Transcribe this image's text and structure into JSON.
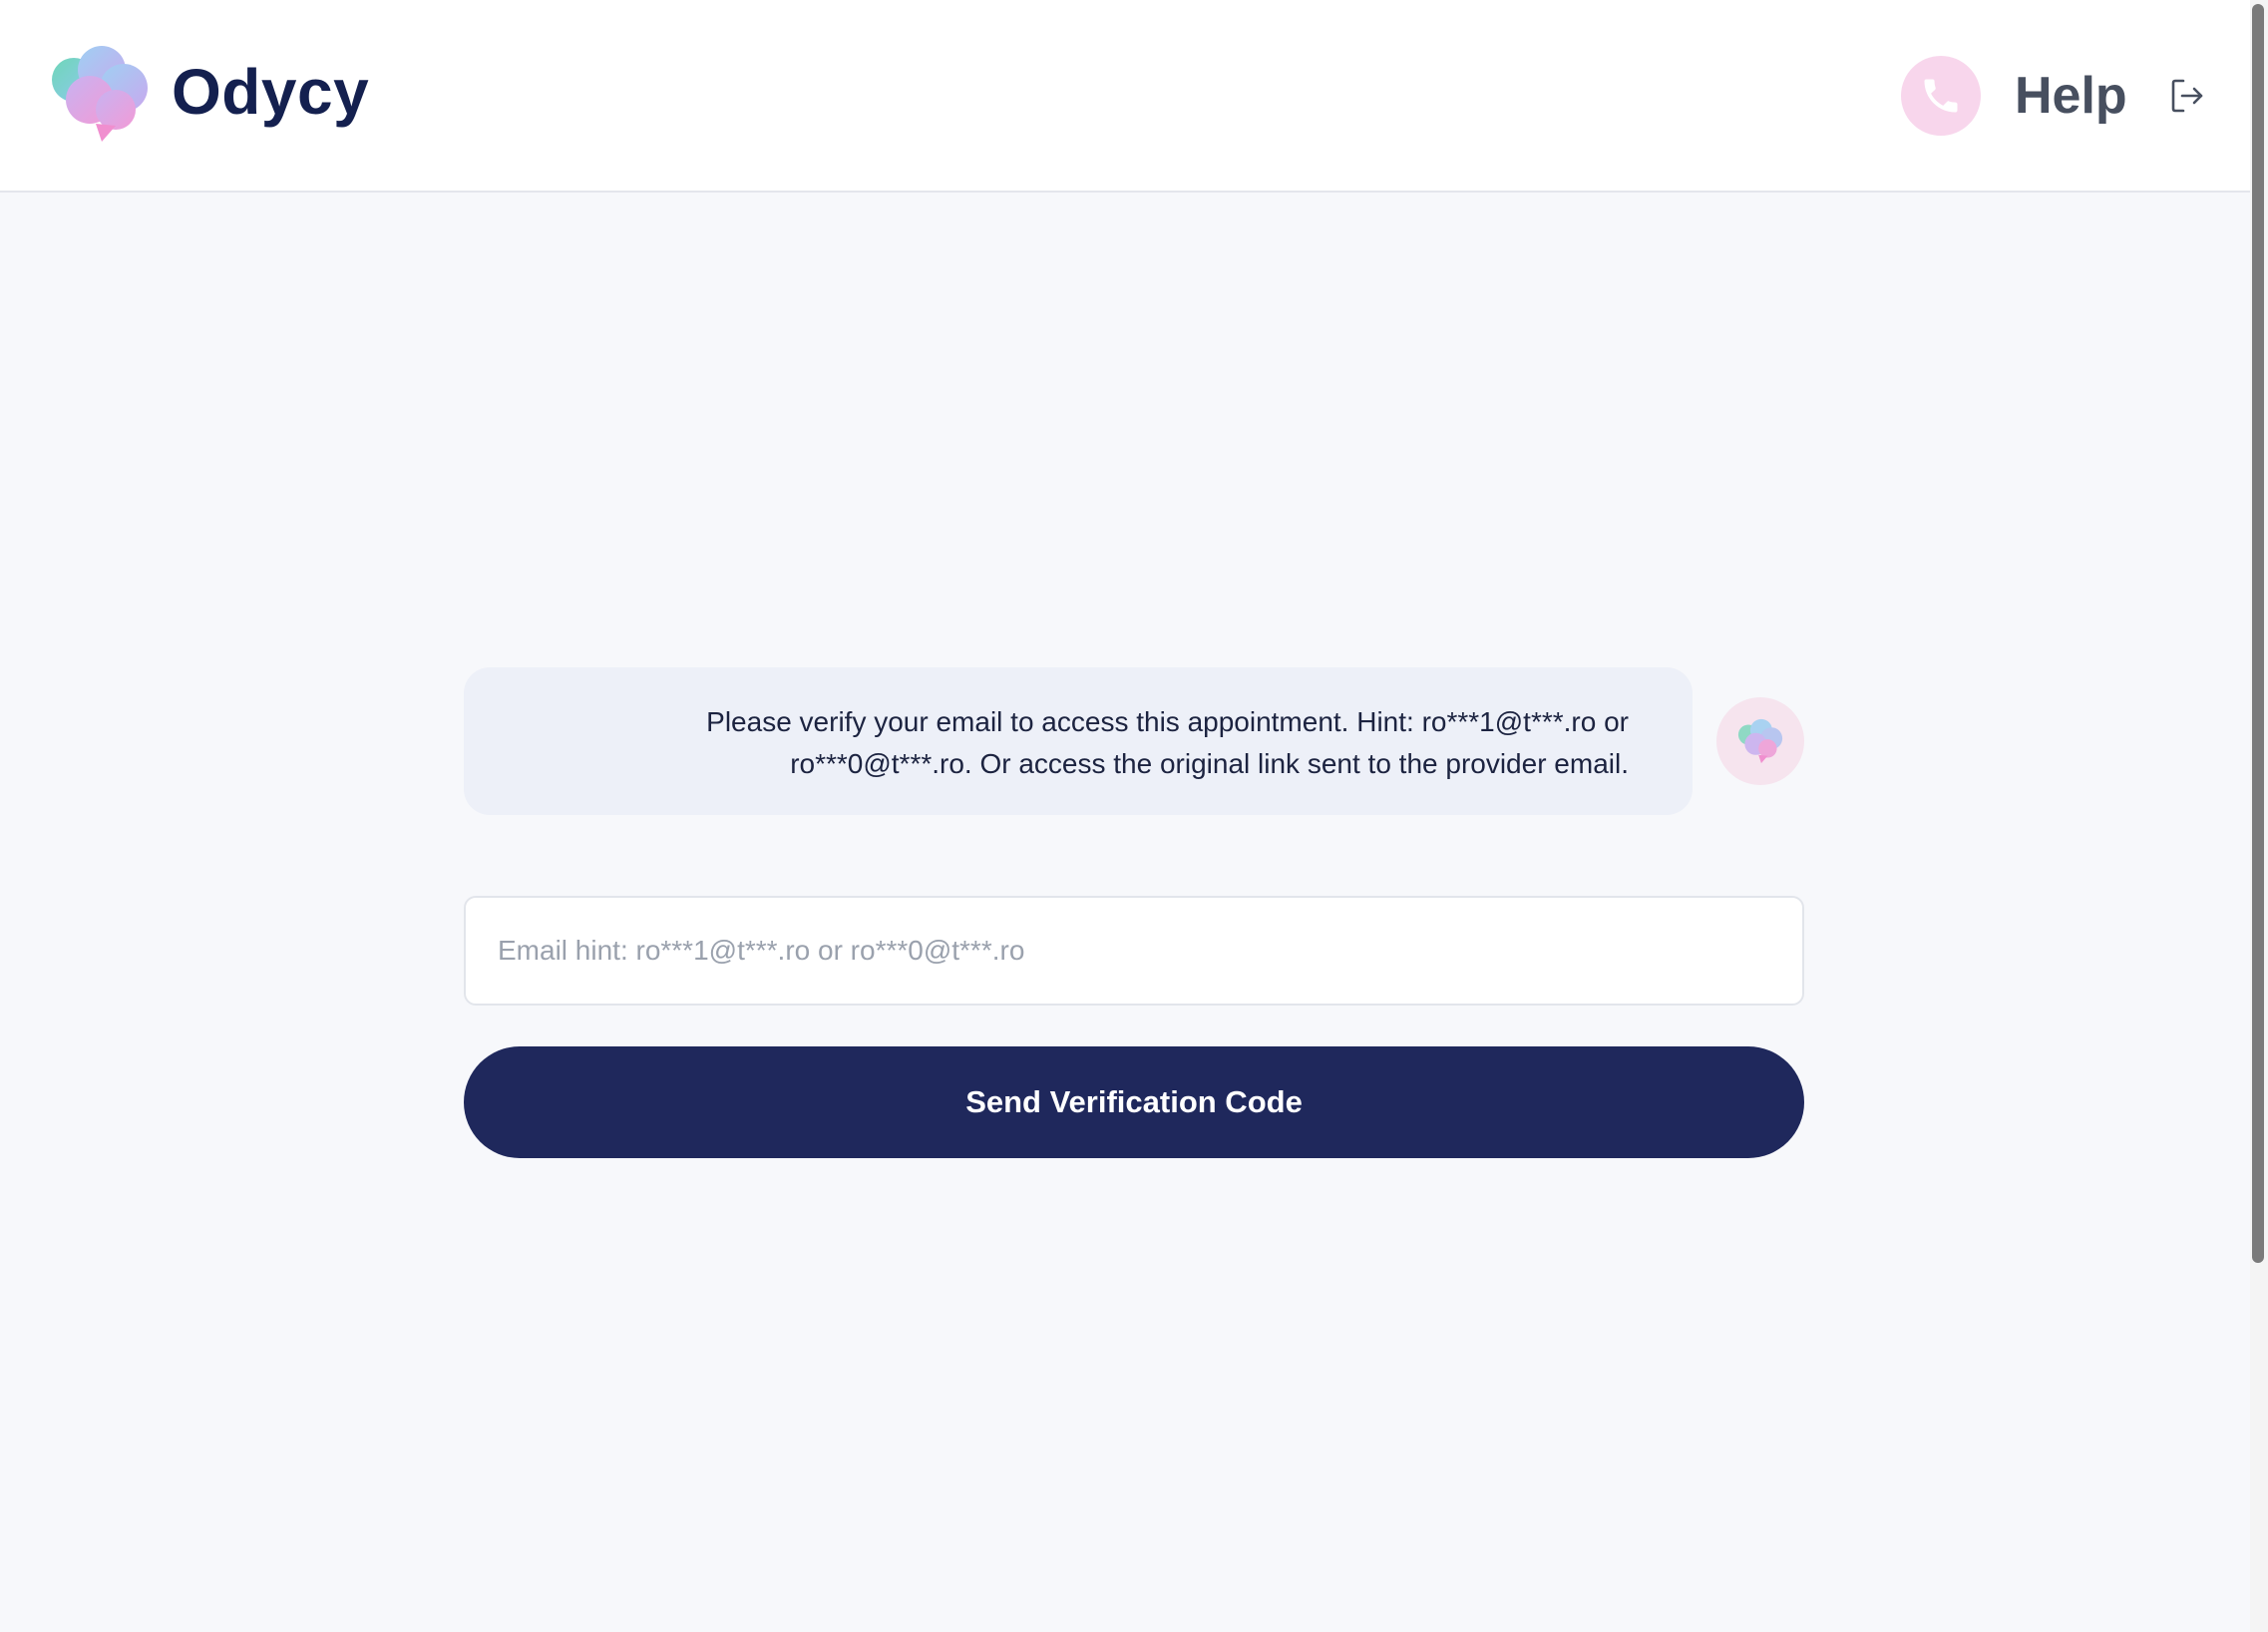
{
  "header": {
    "brand": "Odycy",
    "logo_icon": "brain-cloud-logo-icon",
    "help": {
      "label": "Help",
      "icon": "phone-icon",
      "icon_bg": "#f8d6ec"
    },
    "logout_icon": "logout-icon"
  },
  "chat": {
    "message": "Please verify your email to access this appointment. Hint: ro***1@t***.ro or ro***0@t***.ro. Or access the original link sent to the provider email.",
    "avatar_icon": "brain-avatar-icon",
    "bubble_color": "#edf0f8"
  },
  "form": {
    "email_placeholder": "Email hint: ro***1@t***.ro or ro***0@t***.ro",
    "email_value": "",
    "submit_label": "Send Verification Code",
    "submit_color": "#1f285c"
  },
  "colors": {
    "brand_text": "#14204f",
    "page_background": "#f7f8fb"
  }
}
